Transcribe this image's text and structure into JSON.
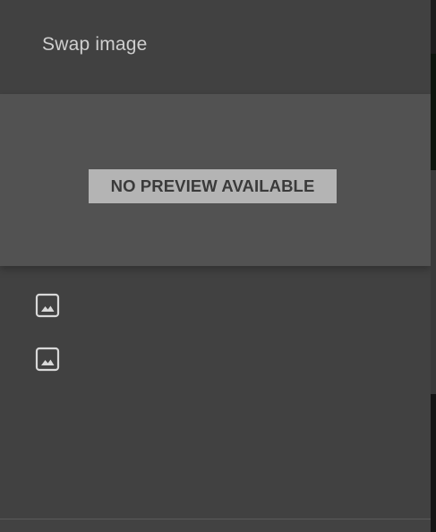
{
  "dialog": {
    "title": "Swap image",
    "preview_placeholder": "NO PREVIEW AVAILABLE",
    "image_options": [
      {
        "icon": "image-icon"
      },
      {
        "icon": "image-icon"
      }
    ]
  },
  "colors": {
    "panel_bg": "#414141",
    "preview_bg": "#525252",
    "placeholder_bg": "#b4b4b4",
    "icon_stroke": "#d8d8d8"
  }
}
